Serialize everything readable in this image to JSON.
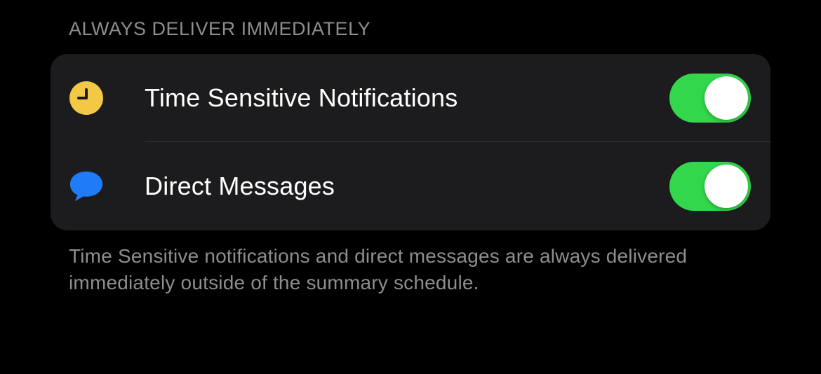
{
  "section": {
    "header": "ALWAYS DELIVER IMMEDIATELY",
    "footer": "Time Sensitive notifications and direct messages are always delivered immediately outside of the summary schedule."
  },
  "rows": [
    {
      "icon": "clock-icon",
      "label": "Time Sensitive Notifications",
      "enabled": true
    },
    {
      "icon": "bubble-icon",
      "label": "Direct Messages",
      "enabled": true
    }
  ],
  "colors": {
    "toggle_on": "#32d74b",
    "bubble": "#1f7bf6",
    "clock": "#f2c844"
  }
}
